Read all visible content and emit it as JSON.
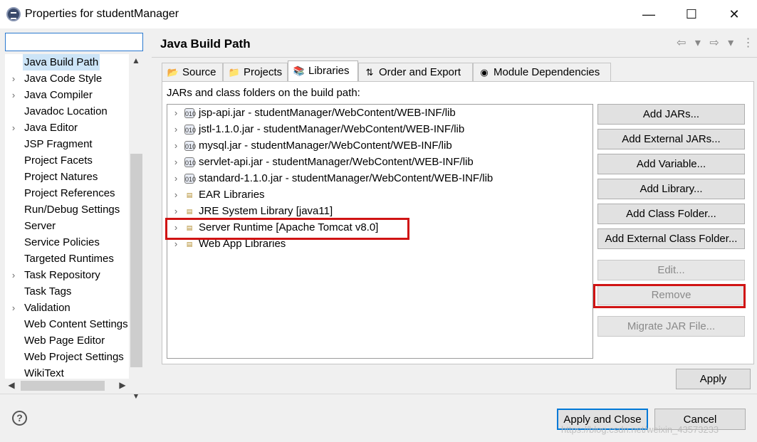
{
  "window": {
    "title": "Properties for studentManager",
    "minimize": "—",
    "maximize": "☐",
    "close": "✕"
  },
  "sidebar": {
    "filter_value": "",
    "items": [
      {
        "label": "Java Build Path",
        "expandable": false,
        "selected": true
      },
      {
        "label": "Java Code Style",
        "expandable": true
      },
      {
        "label": "Java Compiler",
        "expandable": true
      },
      {
        "label": "Javadoc Location",
        "expandable": false
      },
      {
        "label": "Java Editor",
        "expandable": true
      },
      {
        "label": "JSP Fragment",
        "expandable": false
      },
      {
        "label": "Project Facets",
        "expandable": false
      },
      {
        "label": "Project Natures",
        "expandable": false
      },
      {
        "label": "Project References",
        "expandable": false
      },
      {
        "label": "Run/Debug Settings",
        "expandable": false
      },
      {
        "label": "Server",
        "expandable": false
      },
      {
        "label": "Service Policies",
        "expandable": false
      },
      {
        "label": "Targeted Runtimes",
        "expandable": false
      },
      {
        "label": "Task Repository",
        "expandable": true
      },
      {
        "label": "Task Tags",
        "expandable": false
      },
      {
        "label": "Validation",
        "expandable": true
      },
      {
        "label": "Web Content Settings",
        "expandable": false
      },
      {
        "label": "Web Page Editor",
        "expandable": false
      },
      {
        "label": "Web Project Settings",
        "expandable": false
      },
      {
        "label": "WikiText",
        "expandable": false
      }
    ]
  },
  "page": {
    "title": "Java Build Path",
    "nav_icons": "⇦ ▾ ⇨ ▾ ⋮"
  },
  "tabs": [
    {
      "label": "Source",
      "icon": "source-folder-icon",
      "glyph": "📂"
    },
    {
      "label": "Projects",
      "icon": "projects-icon",
      "glyph": "📁"
    },
    {
      "label": "Libraries",
      "icon": "libraries-icon",
      "glyph": "📚",
      "active": true
    },
    {
      "label": "Order and Export",
      "icon": "order-export-icon",
      "glyph": "⇅"
    },
    {
      "label": "Module Dependencies",
      "icon": "module-icon",
      "glyph": "◉"
    }
  ],
  "libraries": {
    "heading": "JARs and class folders on the build path:",
    "entries": [
      {
        "label": "jsp-api.jar - studentManager/WebContent/WEB-INF/lib",
        "kind": "jar"
      },
      {
        "label": "jstl-1.1.0.jar - studentManager/WebContent/WEB-INF/lib",
        "kind": "jar"
      },
      {
        "label": "mysql.jar - studentManager/WebContent/WEB-INF/lib",
        "kind": "jar"
      },
      {
        "label": "servlet-api.jar - studentManager/WebContent/WEB-INF/lib",
        "kind": "jar"
      },
      {
        "label": "standard-1.1.0.jar - studentManager/WebContent/WEB-INF/lib",
        "kind": "jar"
      },
      {
        "label": "EAR Libraries",
        "kind": "library"
      },
      {
        "label": "JRE System Library [java11]",
        "kind": "library"
      },
      {
        "label": "Server Runtime [Apache Tomcat v8.0]",
        "kind": "library",
        "highlighted": true
      },
      {
        "label": "Web App Libraries",
        "kind": "library"
      }
    ]
  },
  "buttons": {
    "add_jars": "Add JARs...",
    "add_external_jars": "Add External JARs...",
    "add_variable": "Add Variable...",
    "add_library": "Add Library...",
    "add_class_folder": "Add Class Folder...",
    "add_external_class_folder": "Add External Class Folder...",
    "edit": "Edit...",
    "remove": "Remove",
    "migrate_jar": "Migrate JAR File...",
    "apply": "Apply",
    "apply_and_close": "Apply and Close",
    "cancel": "Cancel"
  },
  "footer": {
    "help_glyph": "?",
    "watermark": "https://blog.csdn.net/weixin_43573233"
  },
  "colors": {
    "highlight": "#d01414",
    "selection": "#cce4f7",
    "focus": "#2b79d0"
  }
}
